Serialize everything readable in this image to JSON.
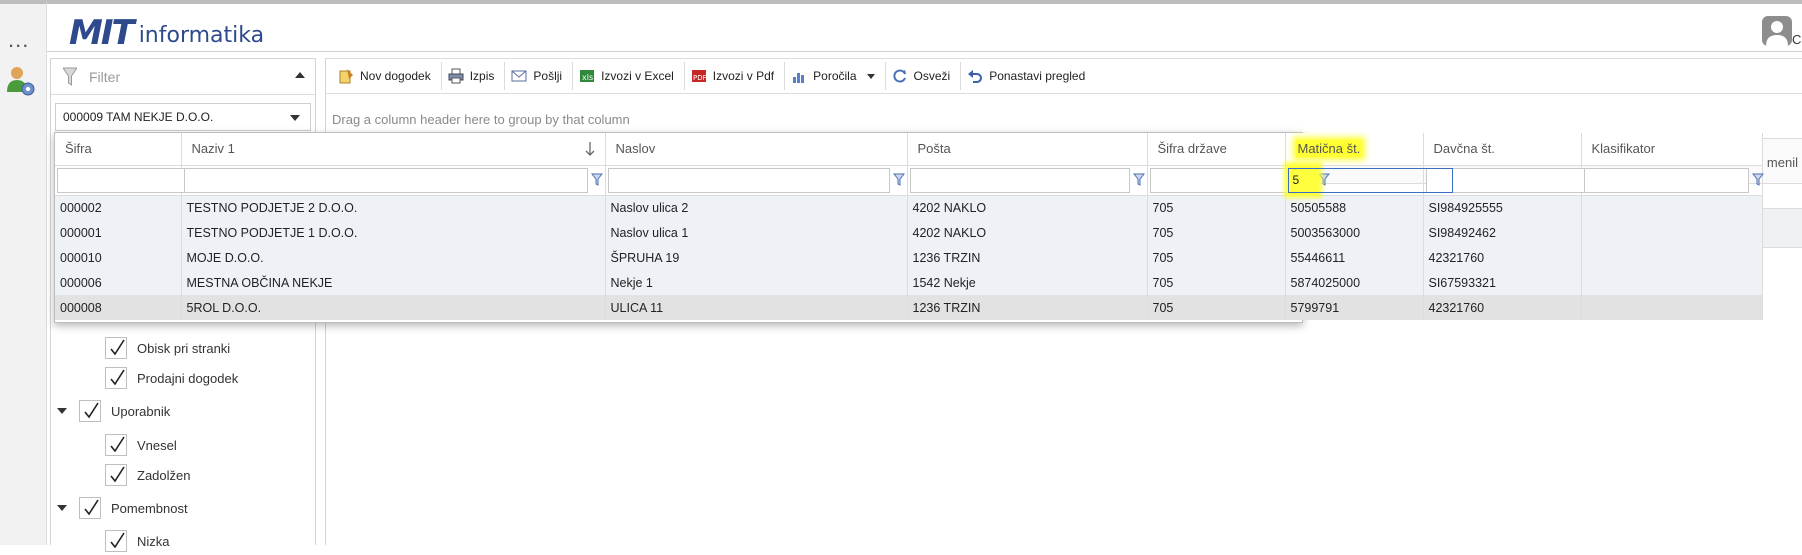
{
  "rail": {
    "dots": "..."
  },
  "header": {
    "logo_main": "MIT",
    "logo_sub": "informatika",
    "user_initial": "C"
  },
  "left_panel": {
    "filter_label": "Filter",
    "company_value": "000009 TAM NEKJE D.O.O.",
    "tree": [
      {
        "label": "Obisk pri stranki",
        "level": 2,
        "checked": true
      },
      {
        "label": "Prodajni dogodek",
        "level": 2,
        "checked": true
      },
      {
        "label": "Uporabnik",
        "level": 1,
        "checked": true
      },
      {
        "label": "Vnesel",
        "level": 2,
        "checked": true
      },
      {
        "label": "Zadolžen",
        "level": 2,
        "checked": true
      },
      {
        "label": "Pomembnost",
        "level": 1,
        "checked": true
      },
      {
        "label": "Nizka",
        "level": 2,
        "checked": true
      }
    ]
  },
  "toolbar": {
    "new_event": "Nov dogodek",
    "print": "Izpis",
    "send": "Pošlji",
    "export_excel": "Izvozi v Excel",
    "export_pdf": "Izvozi v Pdf",
    "reports": "Poročila",
    "refresh": "Osveži",
    "reset_view": "Ponastavi pregled"
  },
  "grid": {
    "group_hint": "Drag a column header here to group by that column",
    "partial_header": "menil"
  },
  "popup": {
    "columns": [
      "Šifra",
      "Naziv 1",
      "Naslov",
      "Pošta",
      "Šifra države",
      "Matična št.",
      "Davčna št.",
      "Klasifikator"
    ],
    "sorted_column": "Naziv 1",
    "highlighted_column": "Matična št.",
    "filters": [
      "",
      "",
      "",
      "",
      "",
      "5",
      "",
      ""
    ],
    "rows": [
      [
        "000002",
        "TESTNO PODJETJE 2 D.O.O.",
        "Naslov ulica 2",
        "4202 NAKLO",
        "705",
        "50505588",
        "SI984925555",
        ""
      ],
      [
        "000001",
        "TESTNO PODJETJE 1 D.O.O.",
        "Naslov ulica 1",
        "4202 NAKLO",
        "705",
        "5003563000",
        "SI98492462",
        ""
      ],
      [
        "000010",
        "MOJE D.O.O.",
        "ŠPRUHA 19",
        "1236 TRZIN",
        "705",
        "55446611",
        "42321760",
        ""
      ],
      [
        "000006",
        "MESTNA OBČINA NEKJE",
        "Nekje 1",
        "1542 Nekje",
        "705",
        "5874025000",
        "SI67593321",
        ""
      ],
      [
        "000008",
        "5ROL D.O.O.",
        "ULICA 11",
        "1236 TRZIN",
        "705",
        "5799791",
        "42321760",
        ""
      ]
    ],
    "selected_row": 4
  },
  "colors": {
    "accent": "#2e4a8c",
    "highlight": "#ffff33",
    "row_bg": "#eef2f7",
    "selected_row": "#e2e2e2"
  }
}
